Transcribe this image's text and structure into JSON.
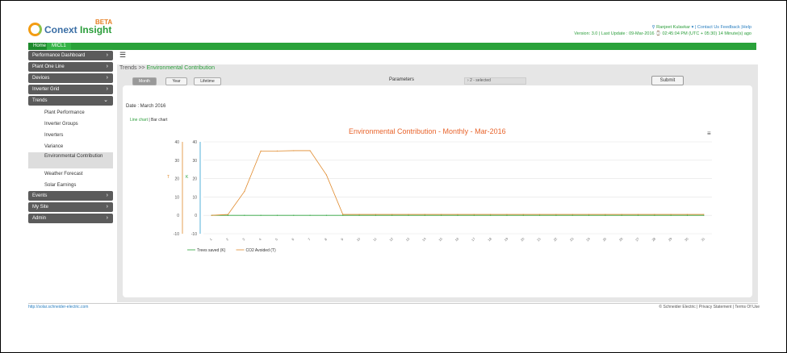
{
  "brand": {
    "name_part1": "Conext ",
    "name_part2": "Insight",
    "beta": "BETA"
  },
  "header": {
    "user": "Ranjeet Kulavkar",
    "links": "Contact Us Feedback |Help",
    "version_line": "Version: 3.0 | Last Update : 09-Mar-2016 ⌚ 02:45:04 PM (UTC + 05:30) 14 Minute(s) ago"
  },
  "breadcrumb": {
    "home": "Home",
    "site": "MICL1"
  },
  "sidebar": {
    "items": [
      {
        "label": "Performance Dashboard"
      },
      {
        "label": "Plant One Line"
      },
      {
        "label": "Devices"
      },
      {
        "label": "Inverter Grid"
      },
      {
        "label": "Trends"
      }
    ],
    "trends_sub": [
      {
        "label": "Plant Performance"
      },
      {
        "label": "Inverter Groups"
      },
      {
        "label": "Inverters"
      },
      {
        "label": "Variance"
      },
      {
        "label": "Environmental Contribution"
      },
      {
        "label": "Weather Forecast"
      },
      {
        "label": "Solar Earnings"
      }
    ],
    "items_after": [
      {
        "label": "Events"
      },
      {
        "label": "My Site"
      },
      {
        "label": "Admin"
      }
    ]
  },
  "page": {
    "title_prefix": "Trends >> ",
    "title_current": "Environmental Contribution",
    "period_buttons": [
      "Month",
      "Year",
      "Lifetime"
    ],
    "params_label": "Parameters",
    "params_value": "2 - selected",
    "submit_label": "Submit",
    "date_line": "Date : March 2016",
    "link_line": "Line chart",
    "link_sep": " | ",
    "link_bar": "Bar chart"
  },
  "chart_data": {
    "type": "line",
    "title": "Environmental Contribution - Monthly - Mar-2016",
    "x": [
      "1",
      "2",
      "3",
      "4",
      "5",
      "6",
      "7",
      "8",
      "9",
      "10",
      "11",
      "12",
      "13",
      "14",
      "15",
      "16",
      "17",
      "18",
      "19",
      "20",
      "21",
      "22",
      "23",
      "24",
      "25",
      "26",
      "27",
      "28",
      "29",
      "30",
      "31"
    ],
    "yticks": [
      -10,
      0,
      10,
      20,
      30,
      40
    ],
    "ylim": [
      -10,
      40
    ],
    "series": [
      {
        "name": "Trees saved (K)",
        "color": "#2aa23a",
        "values": [
          0,
          0,
          0,
          0,
          0,
          0,
          0,
          0,
          0,
          0,
          0,
          0,
          0,
          0,
          0,
          0,
          0,
          0,
          0,
          0,
          0,
          0,
          0,
          0,
          0,
          0,
          0,
          0,
          0,
          0,
          0
        ]
      },
      {
        "name": "CO2 Avoided (T)",
        "color": "#e08a2c",
        "values": [
          0,
          0.5,
          13,
          35,
          35,
          35.2,
          35.2,
          22,
          0.5,
          0.5,
          0.5,
          0.5,
          0.5,
          0.5,
          0.5,
          0.5,
          0.5,
          0.5,
          0.5,
          0.5,
          0.5,
          0.5,
          0.5,
          0.5,
          0.5,
          0.5,
          0.5,
          0.5,
          0.5,
          0.5,
          0.5
        ]
      }
    ],
    "left_axis_label": "T",
    "right_axis_label": "K",
    "legend_position": "bottom-left"
  },
  "footer": {
    "left": "http://solar.schneider-electric.com",
    "right": "© Schneider Electric | Privacy Statement | Terms Of Use"
  }
}
